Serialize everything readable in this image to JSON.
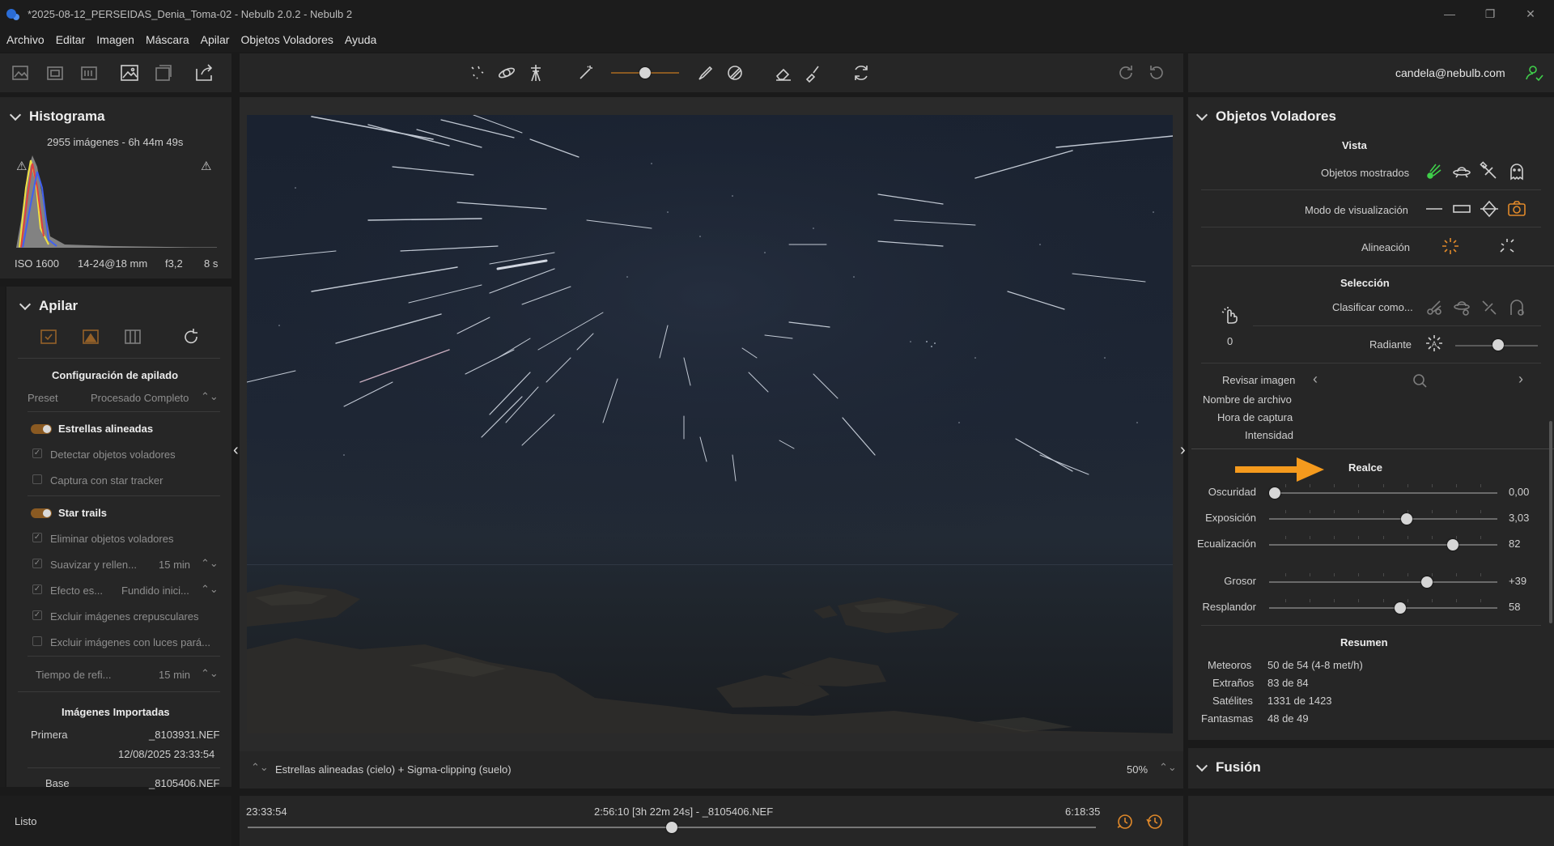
{
  "window": {
    "title": "*2025-08-12_PERSEIDAS_Denia_Toma-02 - Nebulb 2.0.2 - Nebulb 2",
    "controls": [
      "—",
      "❐",
      "✕"
    ]
  },
  "menu": [
    "Archivo",
    "Editar",
    "Imagen",
    "Máscara",
    "Apilar",
    "Objetos Voladores",
    "Ayuda"
  ],
  "account": {
    "email": "candela@nebulb.com"
  },
  "histogram": {
    "title": "Histograma",
    "summary": "2955 imágenes  -  6h 44m 49s",
    "iso": "ISO 1600",
    "lens": "14-24@18 mm",
    "aperture": "f3,2",
    "shutter": "8 s"
  },
  "stack": {
    "title": "Apilar",
    "config_title": "Configuración de apilado",
    "preset_label": "Preset",
    "preset_value": "Procesado Completo",
    "aligned_stars": "Estrellas alineadas",
    "detect_flying": "Detectar objetos voladores",
    "star_tracker": "Captura con star tracker",
    "star_trails": "Star trails",
    "remove_flying": "Eliminar objetos voladores",
    "smooth_label": "Suavizar y rellen...",
    "smooth_value": "15 min",
    "effect_label": "Efecto es...",
    "effect_value": "Fundido inici...",
    "exclude_twilight": "Excluir imágenes crepusculares",
    "exclude_lights": "Excluir imágenes con luces pará...",
    "refresh_label": "Tiempo de refi...",
    "refresh_value": "15 min",
    "imported_title": "Imágenes Importadas",
    "first_label": "Primera",
    "first_file": "_8103931.NEF",
    "first_date": "12/08/2025 23:33:54",
    "base_label": "Base",
    "base_file": "_8105406.NEF"
  },
  "status": {
    "text": "Listo"
  },
  "viewer": {
    "mode": "Estrellas alineadas (cielo) + Sigma-clipping (suelo)",
    "zoom": "50%"
  },
  "timeline": {
    "start": "23:33:54",
    "current": "2:56:10 [3h 22m 24s] - _8105406.NEF",
    "end": "6:18:35",
    "position": 0.5
  },
  "flying": {
    "title": "Objetos Voladores",
    "view_title": "Vista",
    "shown_label": "Objetos mostrados",
    "mode_label": "Modo de visualización",
    "align_label": "Alineación",
    "selection_title": "Selección",
    "classify_label": "Clasificar como...",
    "count": "0",
    "radiant_label": "Radiante",
    "review_label": "Revisar imagen",
    "filename_label": "Nombre de archivo",
    "capture_label": "Hora de captura",
    "intensity_label": "Intensidad",
    "enhance_title": "Realce",
    "sliders": [
      {
        "label": "Oscuridad",
        "value": "0,00",
        "level": 0.0
      },
      {
        "label": "Exposición",
        "value": "3,03",
        "level": 0.61
      },
      {
        "label": "Ecualización",
        "value": "82",
        "level": 0.82
      }
    ],
    "sliders2": [
      {
        "label": "Grosor",
        "value": "+39",
        "level": 0.7
      },
      {
        "label": "Resplandor",
        "value": "58",
        "level": 0.58
      }
    ],
    "summary_title": "Resumen",
    "summary": [
      {
        "label": "Meteoros",
        "value": "50 de 54 (4-8 met/h)"
      },
      {
        "label": "Extraños",
        "value": "83 de 84"
      },
      {
        "label": "Satélites",
        "value": "1331 de 1423"
      },
      {
        "label": "Fantasmas",
        "value": "48 de 49"
      }
    ]
  },
  "fusion": {
    "title": "Fusión"
  },
  "colors": {
    "accent": "#e0892a",
    "green": "#3fcf4a",
    "arrow": "#f59a1d"
  }
}
